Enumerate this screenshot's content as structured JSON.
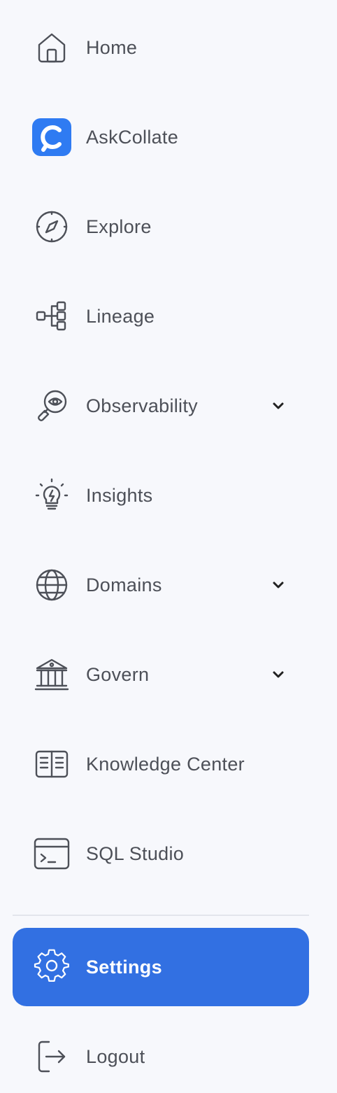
{
  "nav": {
    "home": {
      "label": "Home",
      "icon": "home-icon"
    },
    "askcollate": {
      "label": "AskCollate",
      "icon": "askcollate-logo-icon",
      "brand_color": "#2f7bf2"
    },
    "explore": {
      "label": "Explore",
      "icon": "compass-icon"
    },
    "lineage": {
      "label": "Lineage",
      "icon": "lineage-icon"
    },
    "observability": {
      "label": "Observability",
      "icon": "magnifier-eye-icon",
      "expandable": true
    },
    "insights": {
      "label": "Insights",
      "icon": "lightbulb-icon"
    },
    "domains": {
      "label": "Domains",
      "icon": "globe-icon",
      "expandable": true
    },
    "govern": {
      "label": "Govern",
      "icon": "institution-icon",
      "expandable": true
    },
    "knowledge_center": {
      "label": "Knowledge Center",
      "icon": "book-icon"
    },
    "sql_studio": {
      "label": "SQL Studio",
      "icon": "terminal-icon"
    },
    "settings": {
      "label": "Settings",
      "icon": "gear-icon",
      "active": true
    },
    "logout": {
      "label": "Logout",
      "icon": "logout-icon"
    }
  },
  "colors": {
    "active_bg": "#3270e2",
    "text": "#4d5058",
    "background": "#f7f8fc"
  }
}
